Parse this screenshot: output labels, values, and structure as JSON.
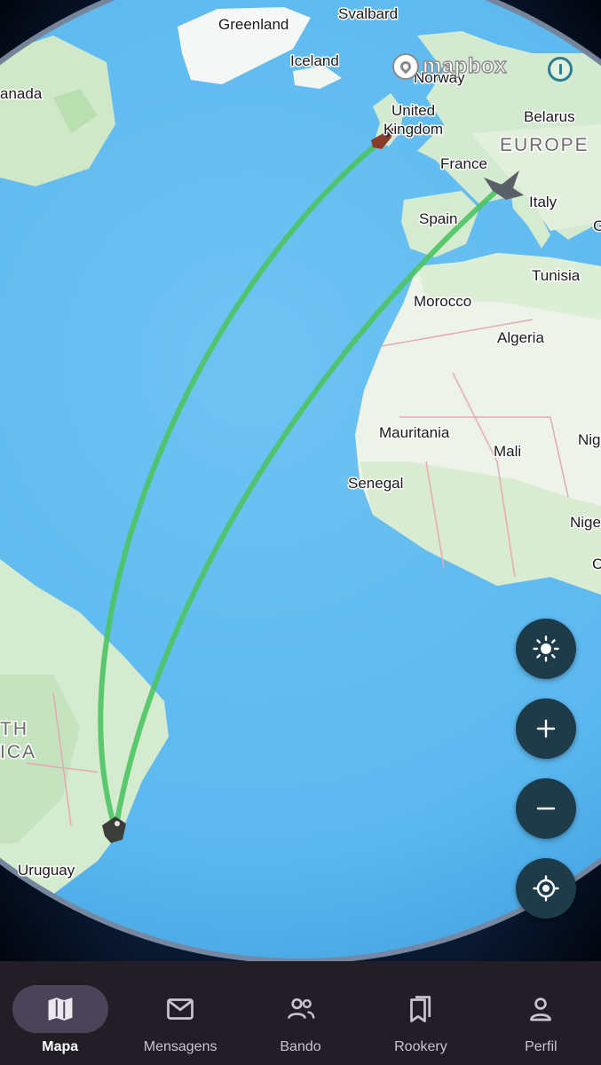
{
  "map": {
    "labels": {
      "greenland": "Greenland",
      "svalbard": "Svalbard",
      "iceland": "Iceland",
      "canada": "anada",
      "norway": "Norway",
      "united_kingdom_1": "United",
      "united_kingdom_2": "Kingdom",
      "belarus": "Belarus",
      "europe": "EUROPE",
      "france": "France",
      "italy": "Italy",
      "spain": "Spain",
      "tunisia": "Tunisia",
      "morocco": "Morocco",
      "algeria": "Algeria",
      "mauritania": "Mauritania",
      "mali": "Mali",
      "niger": "Nig",
      "senegal": "Senegal",
      "nigeria": "Nige",
      "edge_c": "C",
      "edge_g": "G",
      "south_america_1": "TH",
      "south_america_2": "ICA",
      "uruguay": "Uruguay"
    },
    "attribution": "mapbox",
    "route_color": "#4cc462"
  },
  "controls": {
    "theme_icon": "sun-icon",
    "zoom_in_icon": "plus-icon",
    "zoom_out_icon": "minus-icon",
    "locate_icon": "crosshair-icon"
  },
  "nav": {
    "items": [
      {
        "label": "Mapa",
        "icon": "map-icon",
        "active": true
      },
      {
        "label": "Mensagens",
        "icon": "mail-icon",
        "active": false
      },
      {
        "label": "Bando",
        "icon": "group-icon",
        "active": false
      },
      {
        "label": "Rookery",
        "icon": "bookmarks-icon",
        "active": false
      },
      {
        "label": "Perfil",
        "icon": "person-icon",
        "active": false
      }
    ]
  }
}
